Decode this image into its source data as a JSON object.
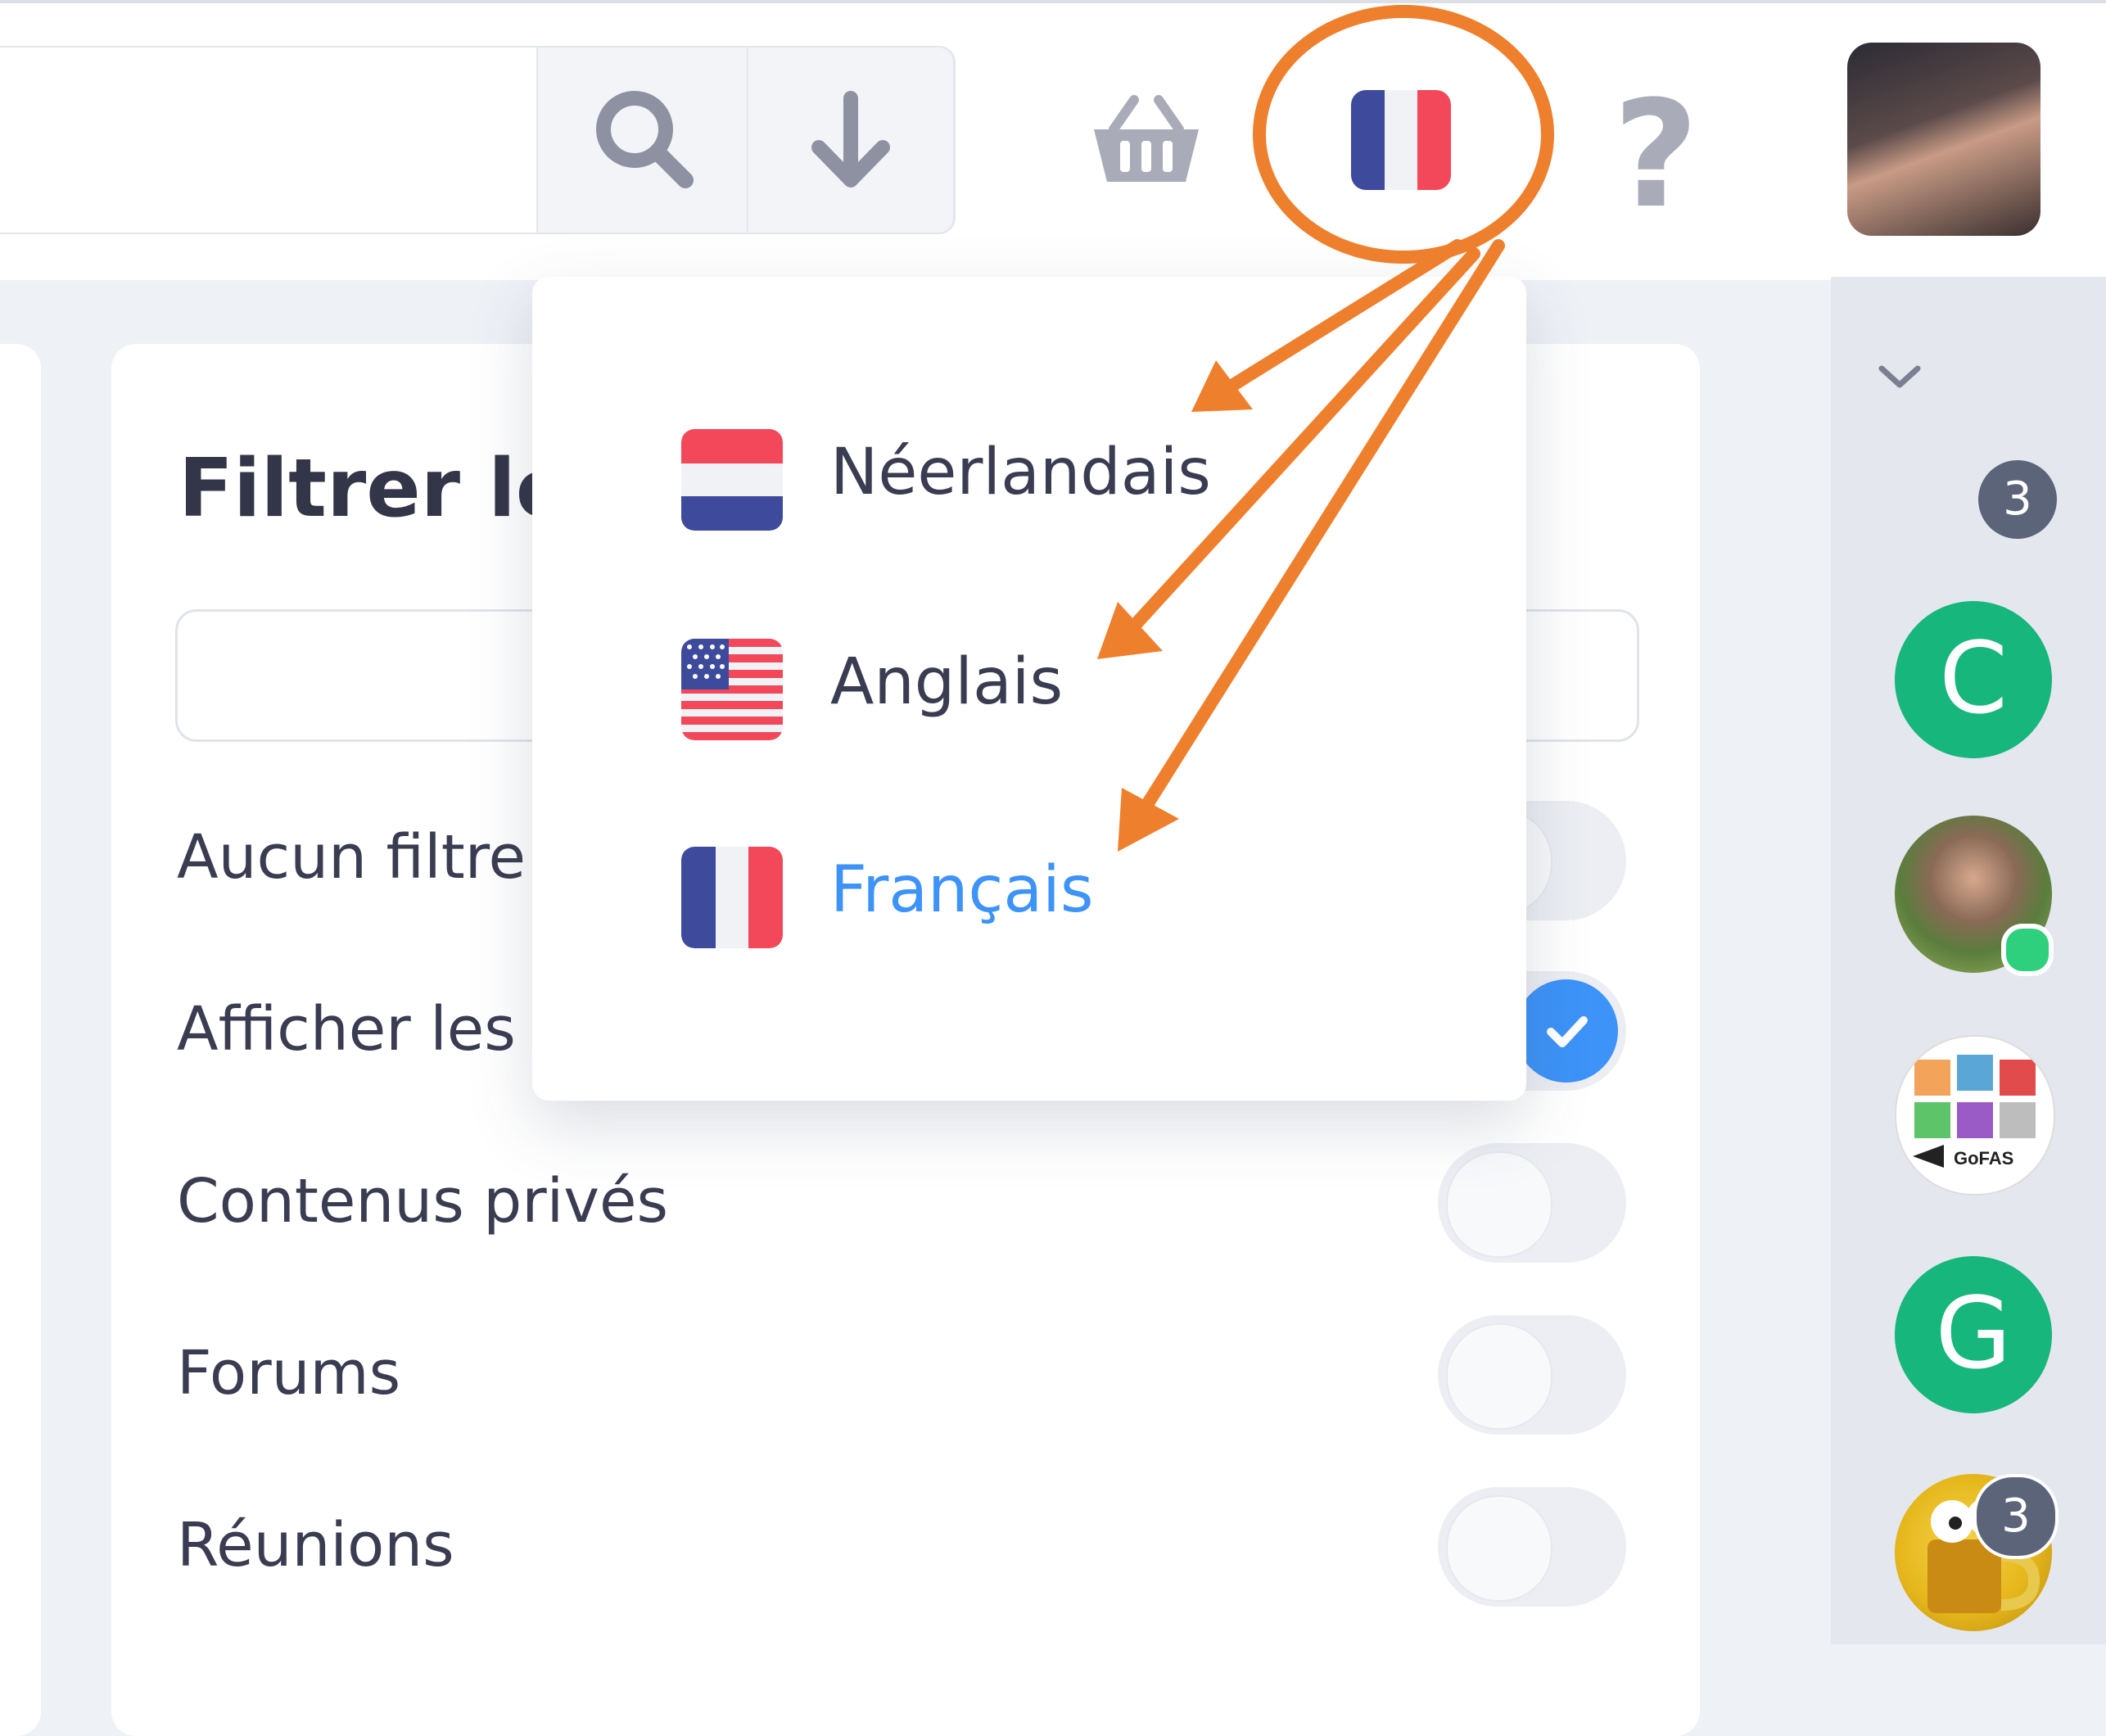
{
  "header": {
    "search_placeholder": "",
    "search_icon": "search-icon",
    "download_icon": "arrow-down-icon",
    "basket_icon": "basket-icon",
    "language_flag": "flag-fr-icon",
    "help_label": "?"
  },
  "filter_panel": {
    "title": "Filtrer le",
    "rows": [
      {
        "label": "Aucun filtre",
        "on": false
      },
      {
        "label": "Afficher les",
        "on": true
      },
      {
        "label": "Contenus privés",
        "on": false
      },
      {
        "label": "Forums",
        "on": false
      },
      {
        "label": "Réunions",
        "on": false
      }
    ]
  },
  "language_menu": {
    "items": [
      {
        "label": "Néerlandais",
        "flag": "flag-nl-icon",
        "active": false
      },
      {
        "label": "Anglais",
        "flag": "flag-us-icon",
        "active": false
      },
      {
        "label": "Français",
        "flag": "flag-fr-icon",
        "active": true
      }
    ]
  },
  "right_sidebar": {
    "top_badge": "3",
    "contacts": [
      {
        "type": "letter",
        "letter": "C",
        "color": "#16b67c"
      },
      {
        "type": "photo",
        "online": true
      },
      {
        "type": "logo",
        "caption": "GoFAS"
      },
      {
        "type": "letter",
        "letter": "G",
        "color": "#16b67c"
      },
      {
        "type": "photo",
        "badge": "3"
      }
    ]
  },
  "colors": {
    "accent": "#3d93f8",
    "annotation": "#ee7f2d",
    "avatar_green": "#16b67c",
    "badge": "#5b6479"
  }
}
